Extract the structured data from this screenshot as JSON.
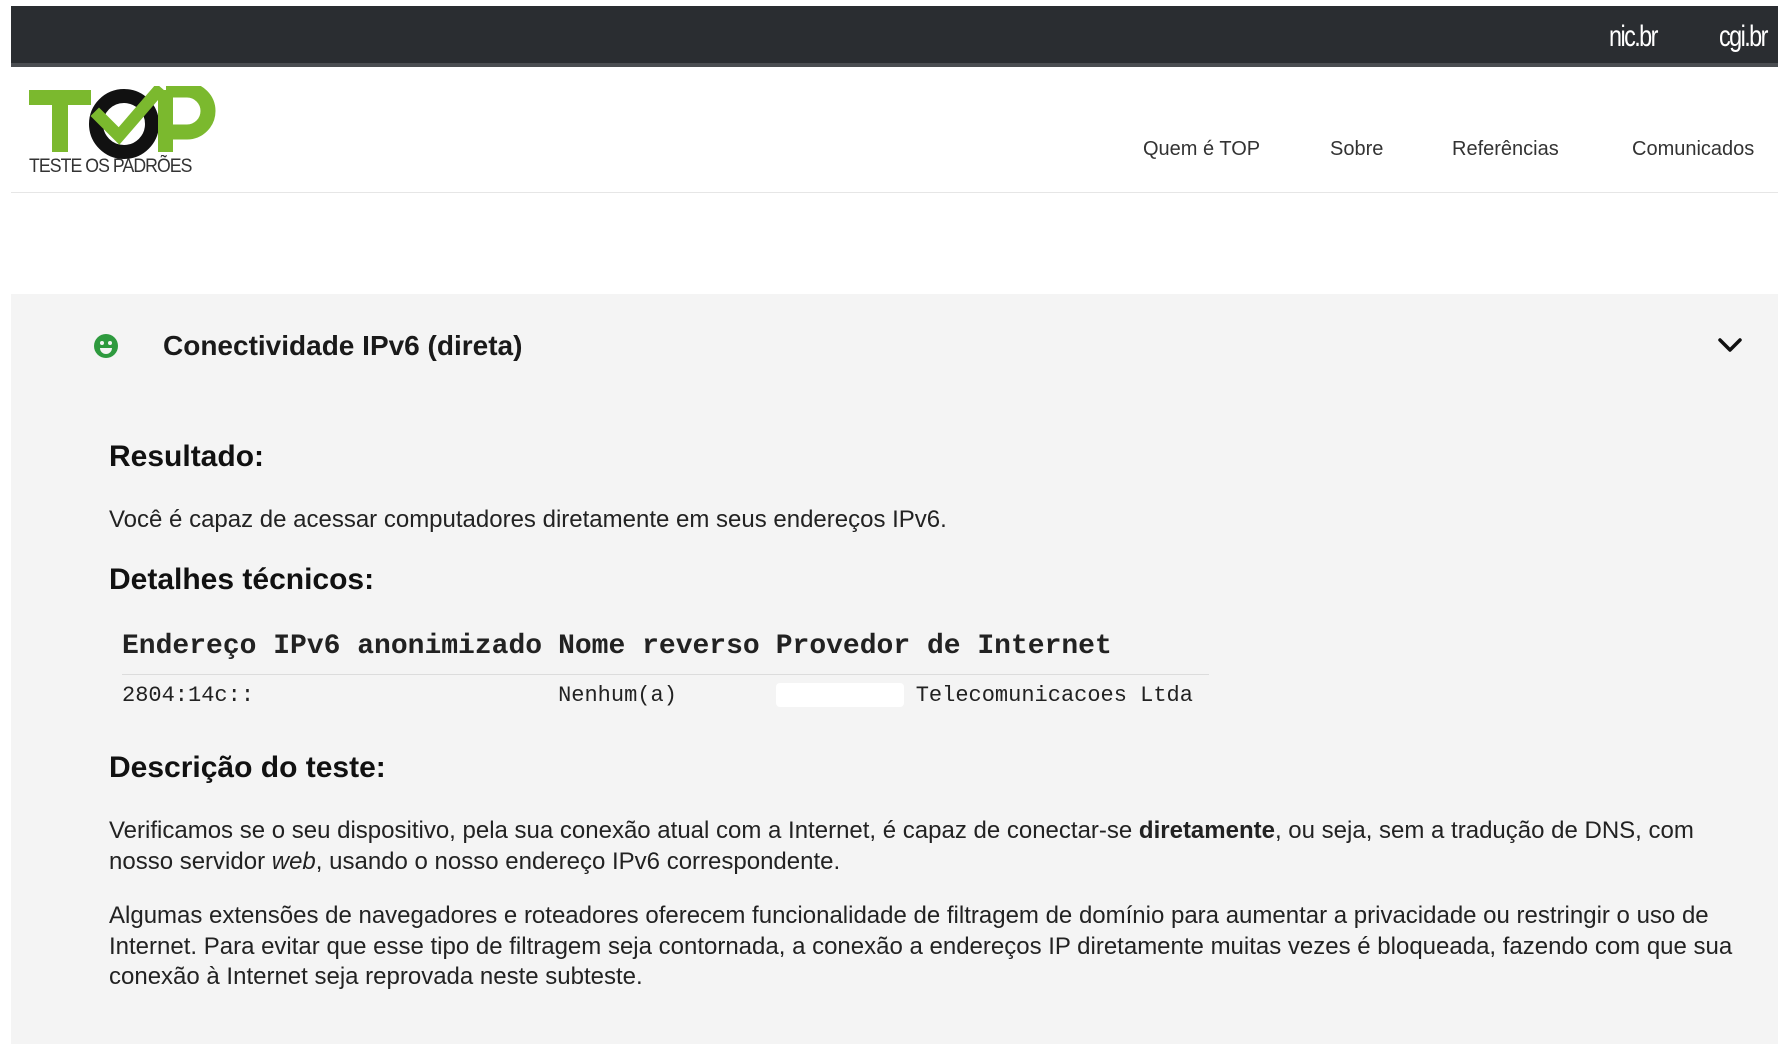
{
  "topbar": {
    "link1": "nic.br",
    "link2": "cgi.br"
  },
  "header": {
    "logo_tagline": "TESTE OS PADRÕES",
    "nav": [
      "Quem é TOP",
      "Sobre",
      "Referências",
      "Comunicados"
    ]
  },
  "colors": {
    "brand_green": "#7bb92e",
    "status_green": "#2e9a3e",
    "topbar": "#2a2d31"
  },
  "panel": {
    "status_icon": "smile-icon",
    "title": "Conectividade IPv6 (direta)",
    "toggle_icon": "chevron-down-icon",
    "result_heading": "Resultado:",
    "result_text": "Você é capaz de acessar computadores diretamente em seus endereços IPv6.",
    "details_heading": "Detalhes técnicos:",
    "table": {
      "headers": [
        "Endereço IPv6 anonimizado",
        "Nome reverso",
        "Provedor de Internet"
      ],
      "row": [
        "2804:14c::",
        "Nenhum(a)",
        "Telecomunicacoes Ltda"
      ]
    },
    "desc_heading": "Descrição do teste:",
    "desc1": {
      "before": "Verificamos se o seu dispositivo, pela sua conexão atual com a Internet, é capaz de conectar-se ",
      "bold": "diretamente",
      "middle": ", ou seja, sem a tradução de DNS, com nosso servidor ",
      "italic": "web",
      "after": ", usando o nosso endereço IPv6 correspondente."
    },
    "desc2": "Algumas extensões de navegadores e roteadores oferecem funcionalidade de filtragem de domínio para aumentar a privacidade ou restringir o uso de Internet. Para evitar que esse tipo de filtragem seja contornada, a conexão a endereços IP diretamente muitas vezes é bloqueada, fazendo com que sua conexão à Internet seja reprovada neste subteste."
  }
}
